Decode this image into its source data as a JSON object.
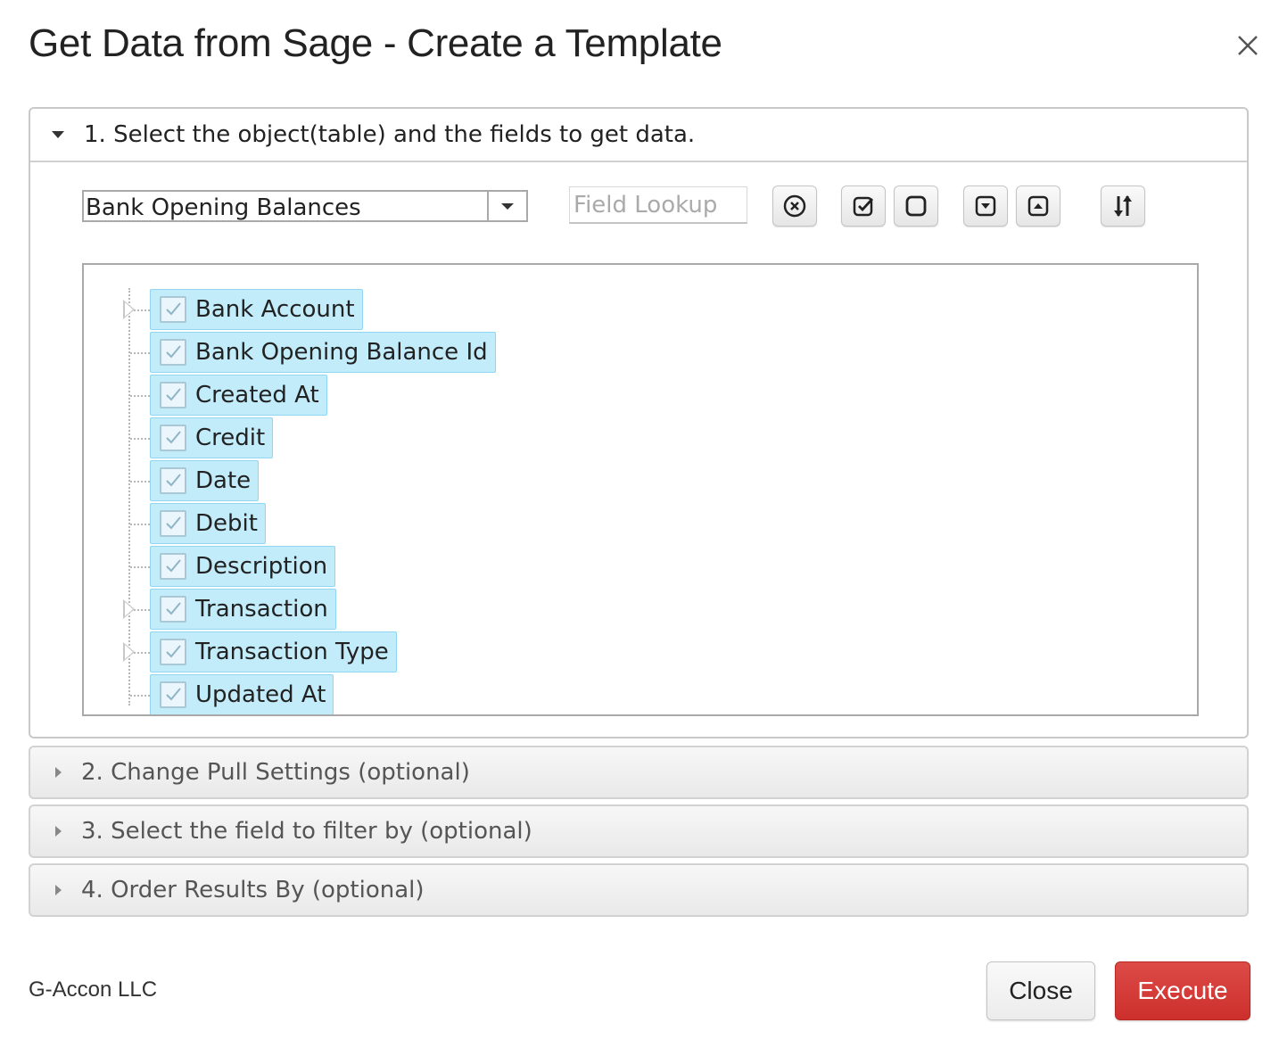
{
  "dialog": {
    "title": "Get Data from Sage - Create a Template"
  },
  "step1": {
    "header": "1. Select the object(table) and the fields to get data.",
    "object_select": {
      "value": "Bank Opening Balances"
    },
    "field_lookup": {
      "placeholder": "Field Lookup",
      "value": ""
    },
    "toolbar_icons": [
      "clear-icon",
      "check-all-icon",
      "uncheck-all-icon",
      "expand-all-icon",
      "collapse-all-icon",
      "sort-icon"
    ],
    "fields": [
      {
        "label": "Bank Account",
        "checked": true,
        "expandable": true
      },
      {
        "label": "Bank Opening Balance Id",
        "checked": true,
        "expandable": false
      },
      {
        "label": "Created At",
        "checked": true,
        "expandable": false
      },
      {
        "label": "Credit",
        "checked": true,
        "expandable": false
      },
      {
        "label": "Date",
        "checked": true,
        "expandable": false
      },
      {
        "label": "Debit",
        "checked": true,
        "expandable": false
      },
      {
        "label": "Description",
        "checked": true,
        "expandable": false
      },
      {
        "label": "Transaction",
        "checked": true,
        "expandable": true
      },
      {
        "label": "Transaction Type",
        "checked": true,
        "expandable": true
      },
      {
        "label": "Updated At",
        "checked": true,
        "expandable": false
      }
    ]
  },
  "step2": {
    "header": "2. Change Pull Settings (optional)"
  },
  "step3": {
    "header": "3. Select the field to filter by (optional)"
  },
  "step4": {
    "header": "4. Order Results By (optional)"
  },
  "footer": {
    "company": "G-Accon LLC",
    "close_label": "Close",
    "execute_label": "Execute"
  },
  "colors": {
    "execute": "#d43a37",
    "node_highlight": "#c3ecfb"
  }
}
